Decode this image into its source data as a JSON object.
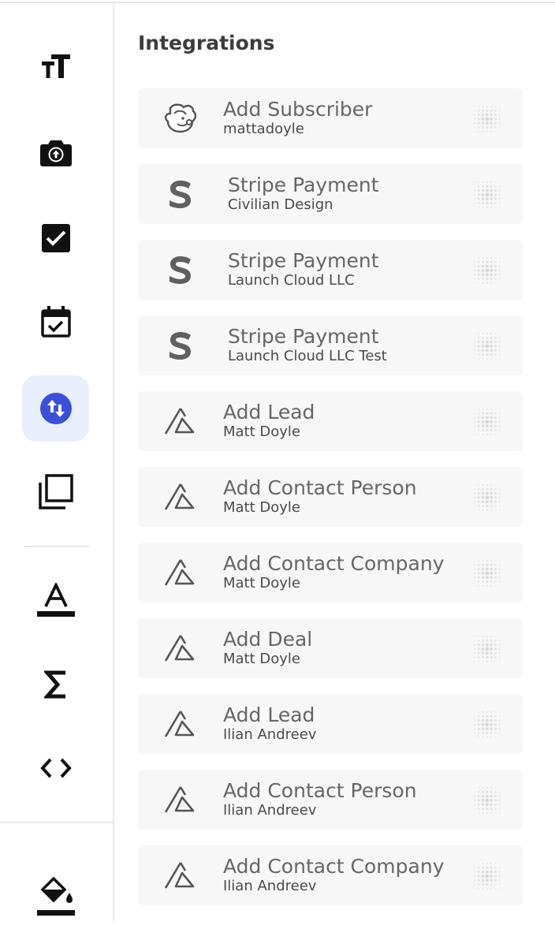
{
  "sidebar": {
    "tools": [
      {
        "icon": "text-size-icon",
        "active": false
      },
      {
        "icon": "camera-upload-icon",
        "active": false
      },
      {
        "icon": "checkbox-icon",
        "active": false
      },
      {
        "icon": "calendar-check-icon",
        "active": false
      },
      {
        "icon": "integrations-swap-icon",
        "active": true
      },
      {
        "icon": "layers-copy-icon",
        "active": false
      },
      {
        "icon": "font-color-icon",
        "active": false
      },
      {
        "icon": "sigma-formula-icon",
        "active": false
      },
      {
        "icon": "code-icon",
        "active": false
      },
      {
        "icon": "paint-bucket-icon",
        "active": false
      }
    ],
    "accent_color": "#3b4fd8",
    "active_bg": "#e8eefb"
  },
  "main": {
    "title": "Integrations",
    "items": [
      {
        "logo": "mailchimp-logo-icon",
        "title": "Add Subscriber",
        "subtitle": "mattadoyle"
      },
      {
        "logo": "stripe-logo-icon",
        "title": "Stripe Payment",
        "subtitle": "Civilian Design"
      },
      {
        "logo": "stripe-logo-icon",
        "title": "Stripe Payment",
        "subtitle": "Launch Cloud LLC"
      },
      {
        "logo": "stripe-logo-icon",
        "title": "Stripe Payment",
        "subtitle": "Launch Cloud LLC Test"
      },
      {
        "logo": "pipedrive-logo-icon",
        "title": "Add Lead",
        "subtitle": "Matt Doyle"
      },
      {
        "logo": "pipedrive-logo-icon",
        "title": "Add Contact Person",
        "subtitle": "Matt Doyle"
      },
      {
        "logo": "pipedrive-logo-icon",
        "title": "Add Contact Company",
        "subtitle": "Matt Doyle"
      },
      {
        "logo": "pipedrive-logo-icon",
        "title": "Add Deal",
        "subtitle": "Matt Doyle"
      },
      {
        "logo": "pipedrive-logo-icon",
        "title": "Add Lead",
        "subtitle": "Ilian Andreev"
      },
      {
        "logo": "pipedrive-logo-icon",
        "title": "Add Contact Person",
        "subtitle": "Ilian Andreev"
      },
      {
        "logo": "pipedrive-logo-icon",
        "title": "Add Contact Company",
        "subtitle": "Ilian Andreev"
      }
    ]
  }
}
